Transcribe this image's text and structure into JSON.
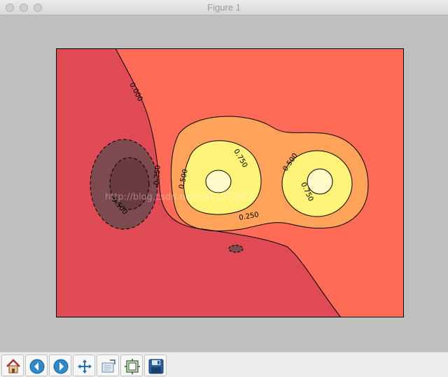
{
  "window": {
    "title": "Figure 1"
  },
  "chart_data": {
    "type": "contour",
    "title": "",
    "xlabel": "",
    "ylabel": "",
    "filled": true,
    "colormap": "hot",
    "levels": [
      -0.5,
      -0.25,
      0.0,
      0.25,
      0.5,
      0.75
    ],
    "contour_labels": [
      "0.000",
      "0.500",
      "0.750",
      "0.500",
      "0.750",
      "0.250",
      "-0.250",
      "-0.500"
    ],
    "grid": false,
    "axes_ticks": "hidden",
    "colors": {
      "region_high": "#fffac8",
      "region_075": "#fff37a",
      "region_050": "#ffa25a",
      "region_025": "#ff6b57",
      "region_000": "#e04a55",
      "region_neg025": "#7d4a4f",
      "region_neg050": "#6a3b3f"
    }
  },
  "watermark": "http://blog.csdn.net/u011372811",
  "toolbar": {
    "buttons": [
      {
        "name": "home-button",
        "icon": "home-icon"
      },
      {
        "name": "back-button",
        "icon": "back-arrow-icon"
      },
      {
        "name": "forward-button",
        "icon": "forward-arrow-icon"
      },
      {
        "name": "pan-button",
        "icon": "move-icon"
      },
      {
        "name": "zoom-button",
        "icon": "zoom-rect-icon"
      },
      {
        "name": "subplots-button",
        "icon": "subplots-icon"
      },
      {
        "name": "save-button",
        "icon": "save-icon"
      }
    ]
  }
}
